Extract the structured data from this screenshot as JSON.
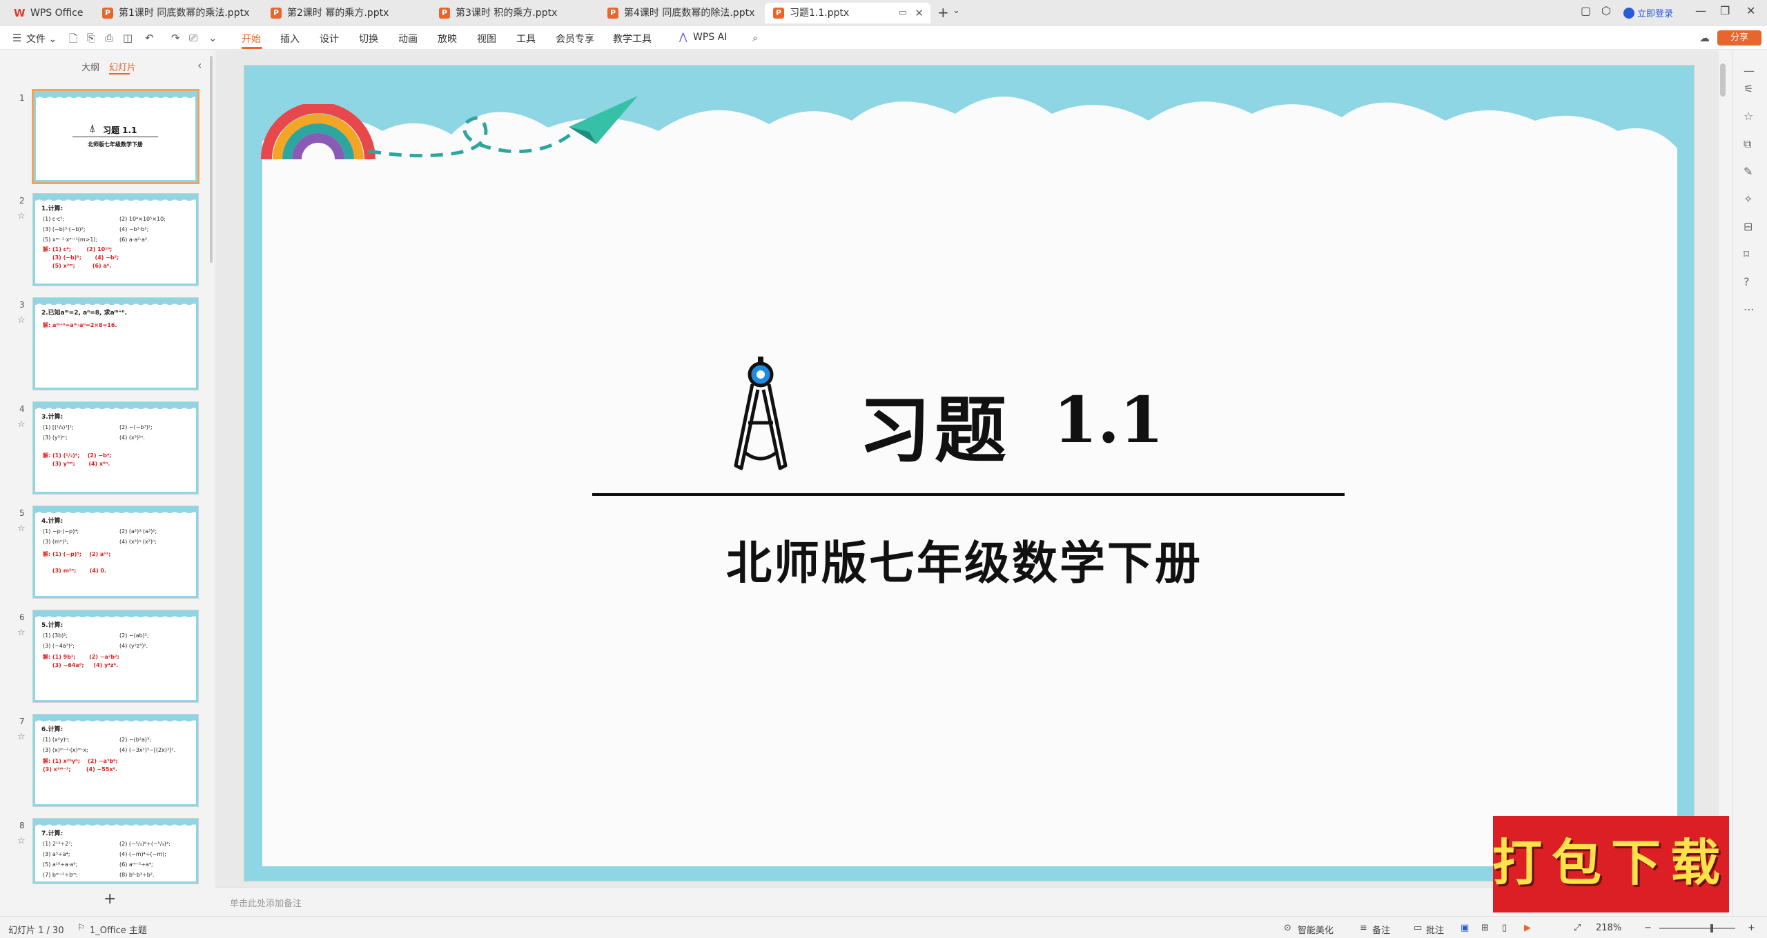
{
  "tabs": [
    {
      "label": "WPS Office",
      "icon": "wps-logo-icon"
    },
    {
      "label": "第1课时 同底数幂的乘法.pptx",
      "icon": "pptx-icon"
    },
    {
      "label": "第2课时 幂的乘方.pptx",
      "icon": "pptx-icon"
    },
    {
      "label": "第3课时 积的乘方.pptx",
      "icon": "pptx-icon"
    },
    {
      "label": "第4课时 同底数幂的除法.pptx",
      "icon": "pptx-icon"
    },
    {
      "label": "习题1.1.pptx",
      "icon": "pptx-icon",
      "active": true
    }
  ],
  "titlebar": {
    "login": "立即登录"
  },
  "menu": {
    "file": "文件",
    "items": [
      "开始",
      "插入",
      "设计",
      "切换",
      "动画",
      "放映",
      "视图",
      "工具",
      "会员专享",
      "教学工具",
      "WPS AI"
    ],
    "active": "开始",
    "share": "分享"
  },
  "leftpanel": {
    "tab_outline": "大纲",
    "tab_slides": "幻灯片",
    "thumbs": [
      {
        "num": "1",
        "title": "习题  1.1",
        "subtitle": "北师版七年级数学下册"
      },
      {
        "num": "2",
        "q": "1.计算:",
        "c1": "(1) c·c⁵;\n(3) (−b)³·(−b)²;\n(5) xᵐ⁻¹·xᵐ⁺¹(m>1);",
        "c2": "(2) 10⁴×10⁵×10;\n(4) −b³·b²;\n(6) a·a²·a³.",
        "ans": "解: (1) c⁶;        (2) 10¹⁰;\n     (3) (−b)⁵;       (4) −b⁵;\n     (5) x²ᵐ;         (6) a⁶."
      },
      {
        "num": "3",
        "q": "2.已知aᵐ=2, aⁿ=8, 求aᵐ⁺ⁿ.",
        "ans": "解: aᵐ⁺ⁿ=aᵐ·aⁿ=2×8=16."
      },
      {
        "num": "4",
        "q": "3.计算:",
        "c1": "(1) [(¹/₃)³]²;\n(3) (y³)ᵐ;",
        "c2": "(2) −(−b³)²;\n(4) (x³)²ⁿ.",
        "ans": "解: (1) (¹/₃)⁶;    (2) −b⁶;\n     (3) y³ᵐ;       (4) x⁶ⁿ."
      },
      {
        "num": "5",
        "q": "4.计算:",
        "c1": "(1) −p·(−p)⁴;\n(3) (mⁿ)²;",
        "c2": "(2) (a²)³·(a³)²;\n(4) (x²)ⁿ·(x²)ⁿ;",
        "ans": "解: (1) (−p)⁵;    (2) a¹²;\n\n     (3) m²ⁿ;       (4) 0."
      },
      {
        "num": "6",
        "q": "5.计算:",
        "c1": "(1) (3b)²;\n(3) (−4a³)²;",
        "c2": "(2) −(ab)²;\n(4) (y²z³)².",
        "ans": "解: (1) 9b²;       (2) −a²b²;\n     (3) −64a⁶;     (4) y⁴z⁶."
      },
      {
        "num": "7",
        "q": "6.计算:",
        "c1": "(1) (x²y)ⁿ;\n(3) (x)ᵐ⁻²·(x)ᵐ·x;",
        "c2": "(2) −(b²a)³;\n(4) (−3x²)³−[(2x)³]².",
        "ans": "解: (1) x²ⁿyⁿ;    (2) −a³b⁶;\n(3) x²ᵐ⁻¹;        (4) −55x⁶."
      },
      {
        "num": "8",
        "q": "7.计算:",
        "c1": "(1) 2¹³÷2⁷;\n(3) a⁵÷a⁴;\n(5) a¹⁰÷a·a⁹;\n(7) bᵐ⁺²÷bᵐ;",
        "c2": "(2) (−⁵/₃)⁶÷(−⁵/₃)⁴;\n(4) (−m)⁴÷(−m);\n(6) aᵐ⁺²÷a⁴;\n(8) b⁵·b³÷b²."
      }
    ]
  },
  "slide": {
    "title": "习题",
    "number": "1.1",
    "subtitle": "北师版七年级数学下册"
  },
  "notes_placeholder": "单击此处添加备注",
  "statusbar": {
    "slide_index": "幻灯片 1 / 30",
    "theme": "1_Office 主题",
    "beautify": "智能美化",
    "notes": "备注",
    "comments": "批注",
    "zoom": "218%"
  },
  "watermark": {
    "text": "打包下载"
  },
  "colors": {
    "accent": "#e8652b",
    "slide_sky": "#8fd6e4",
    "answer_red": "#e02020",
    "badge_red": "#dc1f24",
    "badge_text": "#fde24a"
  }
}
